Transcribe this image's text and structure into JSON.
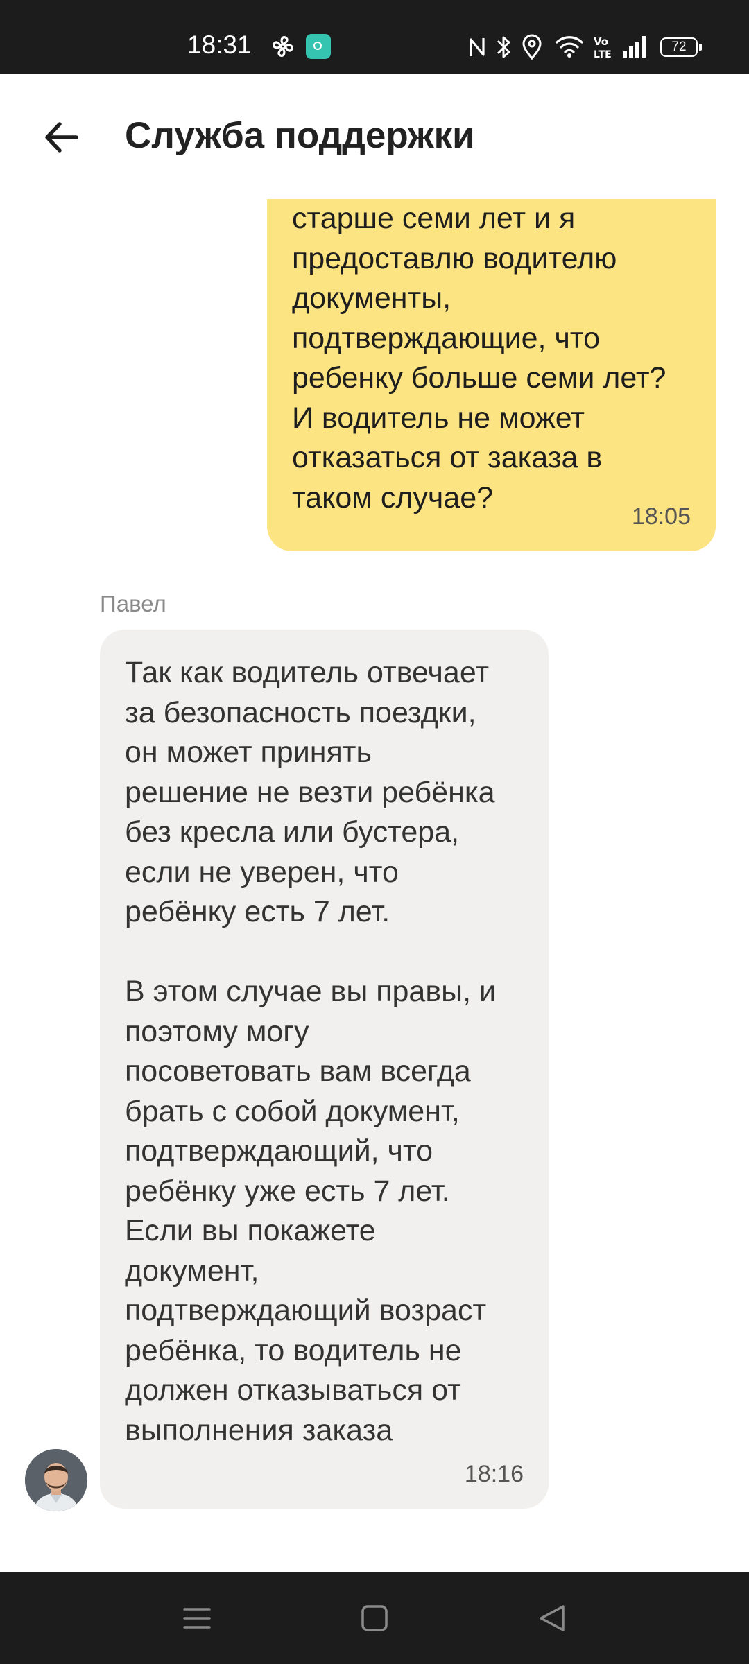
{
  "status_bar": {
    "time": "18:31",
    "battery_level": "72",
    "icons": [
      "fan-icon",
      "app-notification-icon",
      "nfc-icon",
      "bluetooth-icon",
      "location-icon",
      "wifi-icon",
      "volte-icon",
      "signal-icon",
      "battery-icon"
    ]
  },
  "header": {
    "title": "Служба поддержки",
    "back_icon": "arrow-left-icon"
  },
  "messages": [
    {
      "from": "user",
      "text": "старше семи лет и я\nпредоставлю водителю\nдокументы,\nподтверждающие, что\nребенку больше семи лет?\nИ водитель не может\nотказаться от заказа в\nтаком случае?",
      "time": "18:05"
    },
    {
      "from": "agent",
      "sender": "Павел",
      "text": "Так как водитель отвечает\nза безопасность поездки,\nон может принять\nрешение не везти ребёнка\nбез кресла или бустера,\nесли не уверен, что\nребёнку есть 7 лет.\n\nВ этом случае вы правы, и\nпоэтому могу\nпосоветовать вам всегда\nбрать с собой документ,\nподтверждающий, что\nребёнку уже есть 7 лет.\nЕсли вы покажете\nдокумент,\nподтверждающий возраст\nребёнка, то водитель не\nдолжен отказываться от\nвыполнения заказа",
      "time": "18:16"
    }
  ],
  "nav_bar": {
    "icons": [
      "menu-icon",
      "home-icon",
      "back-triangle-icon"
    ]
  },
  "colors": {
    "user_bubble": "#fde482",
    "agent_bubble": "#f1f0ee",
    "system_bars": "#1c1c1c"
  }
}
